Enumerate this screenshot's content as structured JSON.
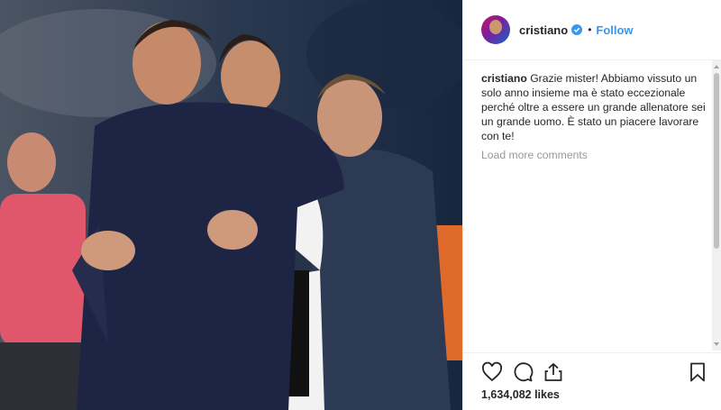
{
  "post": {
    "photo_alt": "Cristiano Ronaldo hugging coach"
  },
  "header": {
    "username": "cristiano",
    "dot": "•",
    "follow_label": "Follow"
  },
  "caption": {
    "username": "cristiano",
    "text": "Grazie mister! Abbiamo vissuto un solo anno insieme ma è stato eccezionale perché oltre a essere un grande allenatore sei un grande uomo. È stato un piacere lavorare con te!"
  },
  "comments": {
    "load_more_label": "Load more comments"
  },
  "likes": {
    "count_text": "1,634,082 likes"
  },
  "colors": {
    "link": "#3897f0",
    "text": "#262626",
    "muted": "#999999"
  },
  "icons": [
    "heart-icon",
    "comment-icon",
    "share-icon",
    "bookmark-icon",
    "verified-badge-icon"
  ]
}
